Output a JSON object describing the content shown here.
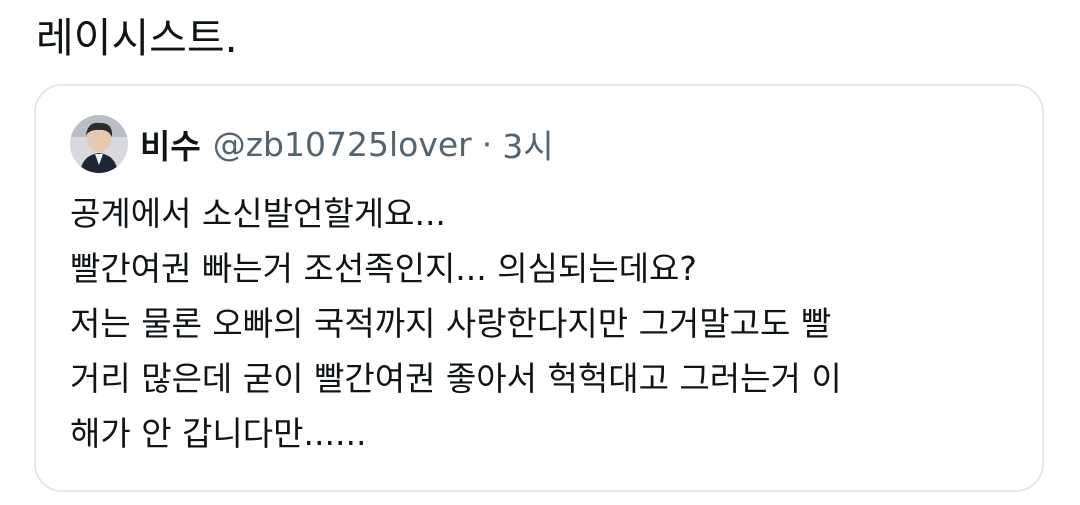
{
  "tweet": {
    "text": "레이시스트."
  },
  "quote": {
    "display_name": "비수",
    "handle": "@zb10725lover",
    "separator": "·",
    "time": "3시",
    "lines": [
      "공계에서 소신발언할게요...",
      "빨간여권 빠는거 조선족인지... 의심되는데요?",
      "저는 물론 오빠의 국적까지 사랑한다지만 그거말고도 빨",
      "거리 많은데 굳이 빨간여권 좋아서 헉헉대고 그러는거 이",
      "해가 안 갑니다만......"
    ]
  },
  "colors": {
    "primary_text": "#0f1419",
    "secondary_text": "#536471",
    "card_border": "#e1e8ed"
  },
  "icons": {
    "avatar": "profile-photo"
  }
}
